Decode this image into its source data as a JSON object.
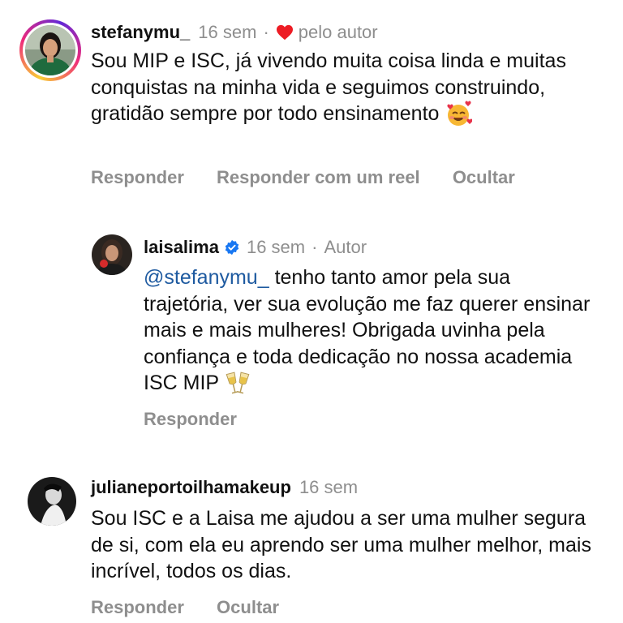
{
  "comments": [
    {
      "username": "stefanymu_",
      "time": "16 sem",
      "liked_by_author_label": "pelo autor",
      "text": "Sou MIP e ISC, já vivendo muita coisa linda e muitas conquistas na minha vida e seguimos construindo, gratidão sempre por todo ensinamento",
      "emoji": "smiling-face-with-hearts",
      "actions": [
        "Responder",
        "Responder com um reel",
        "Ocultar"
      ]
    },
    {
      "username": "laisalima",
      "verified": true,
      "time": "16 sem",
      "author_label": "Autor",
      "mention": "@stefanymu_",
      "text": "tenho tanto amor pela sua trajetória, ver sua evolução me faz querer ensinar mais e mais mulheres! Obrigada uvinha pela confiança e toda dedicação no nossa academia ISC MIP",
      "emoji": "clinking-glasses",
      "actions": [
        "Responder"
      ]
    },
    {
      "username": "julianeportoilhamakeup",
      "time": "16 sem",
      "text": "Sou ISC e a Laisa me ajudou a ser uma mulher segura de si, com ela eu aprendo ser uma mulher melhor, mais incrível, todos os dias.",
      "actions": [
        "Responder",
        "Ocultar"
      ]
    }
  ],
  "colors": {
    "heart": "#ed1c24",
    "verified": "#1877f2",
    "meta_gray": "#8e8e8e",
    "mention": "#1e5aa0"
  }
}
